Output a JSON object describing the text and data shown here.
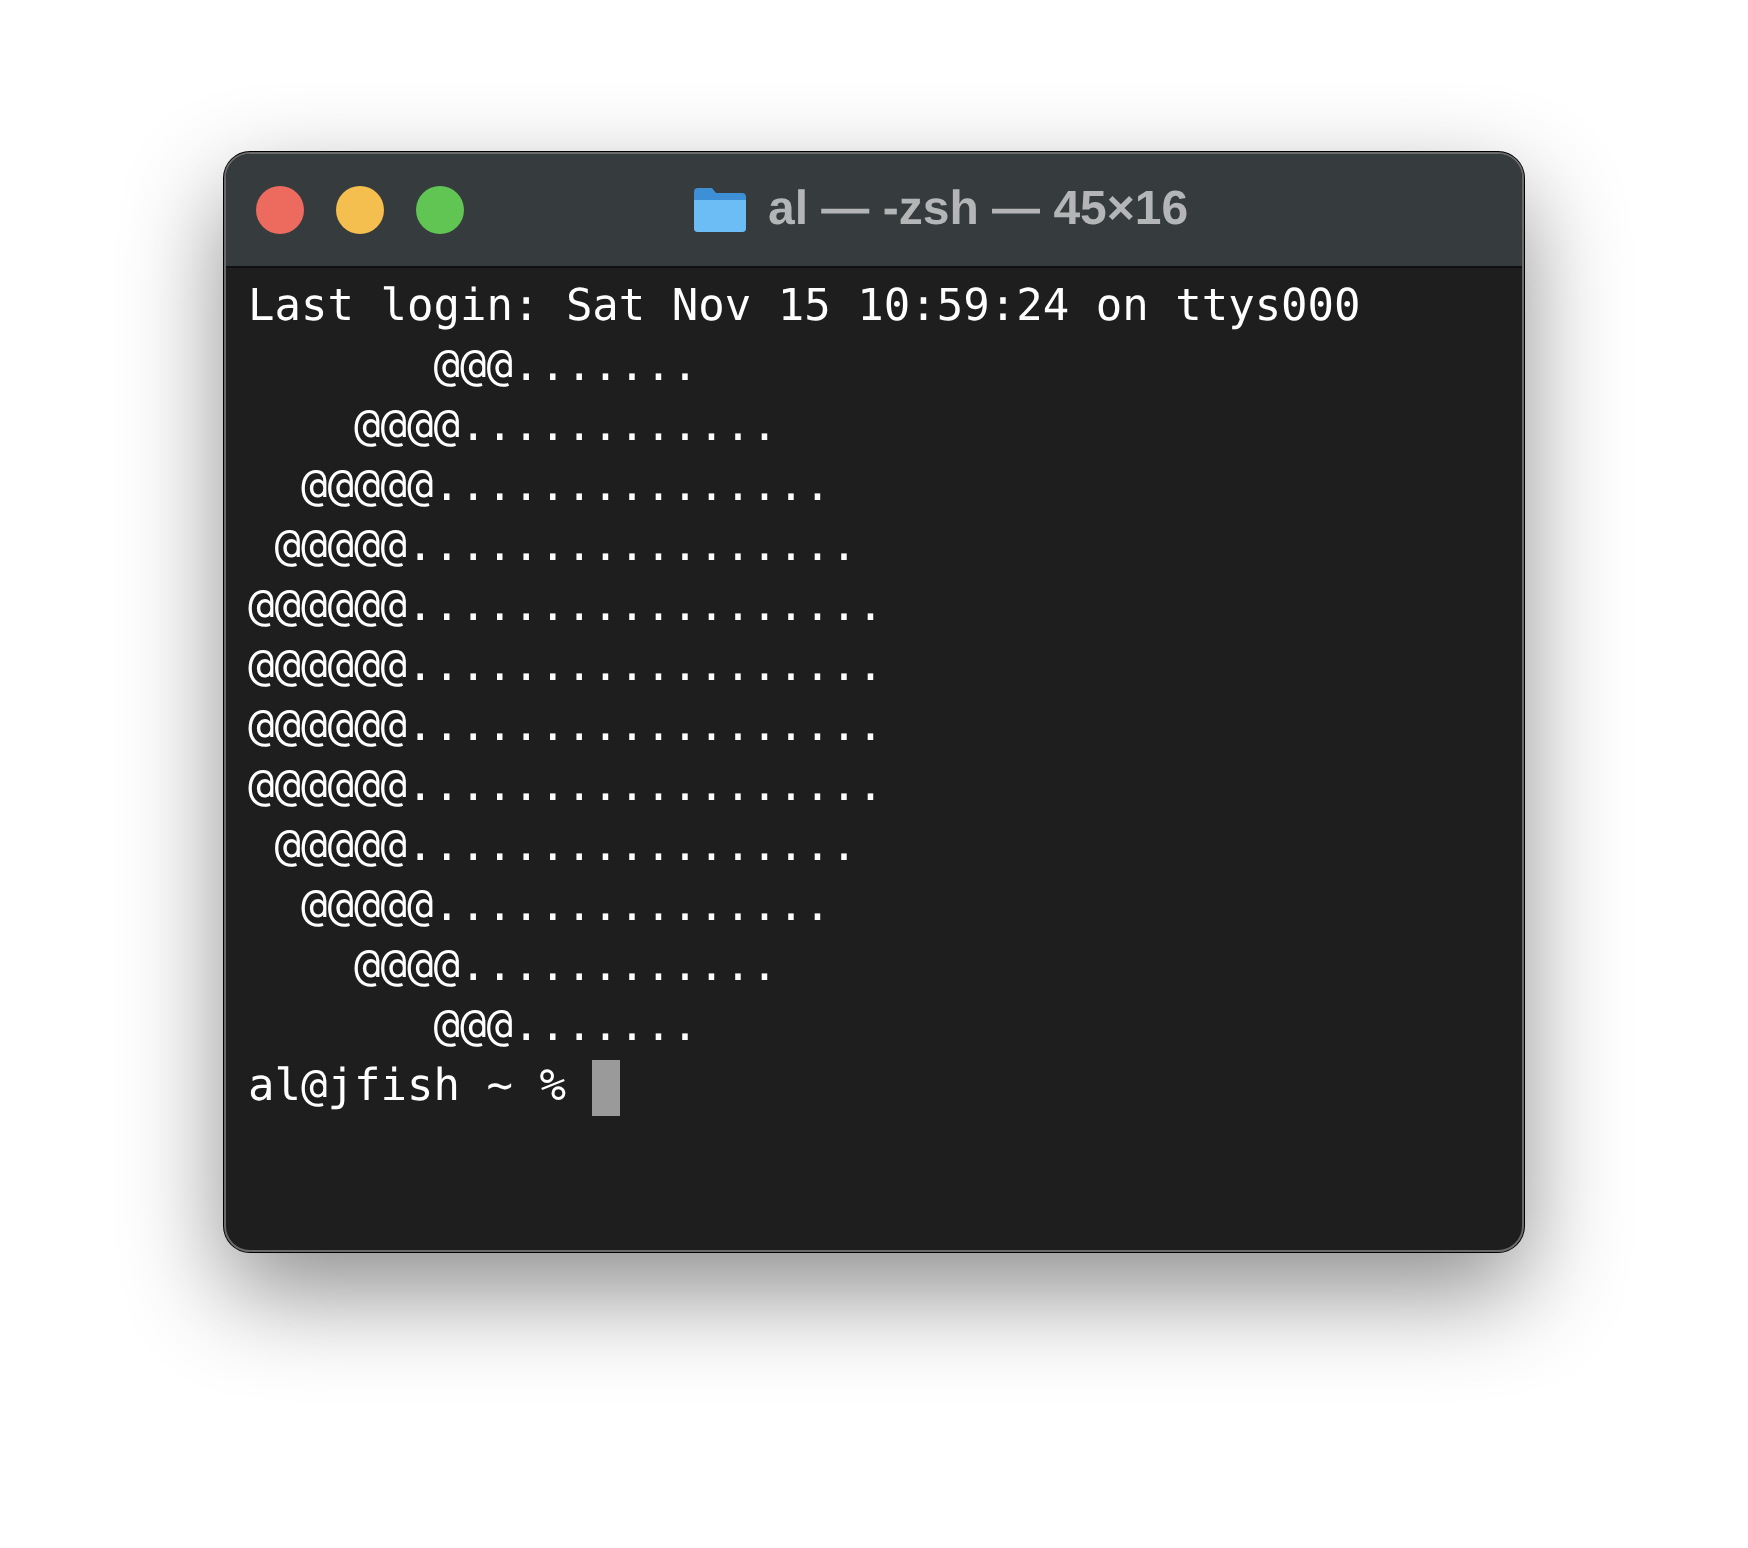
{
  "window": {
    "title": "al — -zsh — 45×16"
  },
  "terminal": {
    "lines": [
      "Last login: Sat Nov 15 10:59:24 on ttys000",
      "       @@@.......",
      "    @@@@............",
      "  @@@@@...............",
      " @@@@@.................",
      "@@@@@@..................",
      "@@@@@@..................",
      "@@@@@@..................",
      "@@@@@@..................",
      " @@@@@.................",
      "  @@@@@...............",
      "    @@@@............",
      "       @@@......."
    ],
    "prompt": "al@jfish ~ %"
  }
}
